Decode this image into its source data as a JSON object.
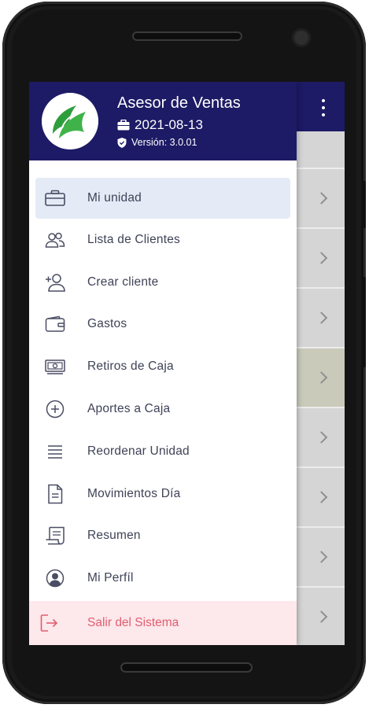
{
  "header": {
    "role": "Asesor de Ventas",
    "date": "2021-08-13",
    "version": "Versión: 3.0.01"
  },
  "menu": [
    {
      "label": "Mi unidad",
      "icon": "briefcase-icon",
      "active": true
    },
    {
      "label": "Lista de Clientes",
      "icon": "users-icon"
    },
    {
      "label": "Crear cliente",
      "icon": "add-user-icon"
    },
    {
      "label": "Gastos",
      "icon": "wallet-icon"
    },
    {
      "label": "Retiros de Caja",
      "icon": "cash-icon"
    },
    {
      "label": "Aportes a Caja",
      "icon": "plus-circle-icon"
    },
    {
      "label": "Reordenar Unidad",
      "icon": "list-icon"
    },
    {
      "label": "Movimientos Día",
      "icon": "document-icon"
    },
    {
      "label": "Resumen",
      "icon": "receipt-icon"
    },
    {
      "label": "Mi Perfíl",
      "icon": "user-circle-icon"
    }
  ],
  "logout": {
    "label": "Salir del Sistema",
    "icon": "logout-icon"
  },
  "colors": {
    "primary": "#1d1a66",
    "active_bg": "#e4ebf6",
    "logout_bg": "#fde8ec",
    "logout_text": "#e25d6e",
    "logo_green": "#2e9e3c"
  }
}
